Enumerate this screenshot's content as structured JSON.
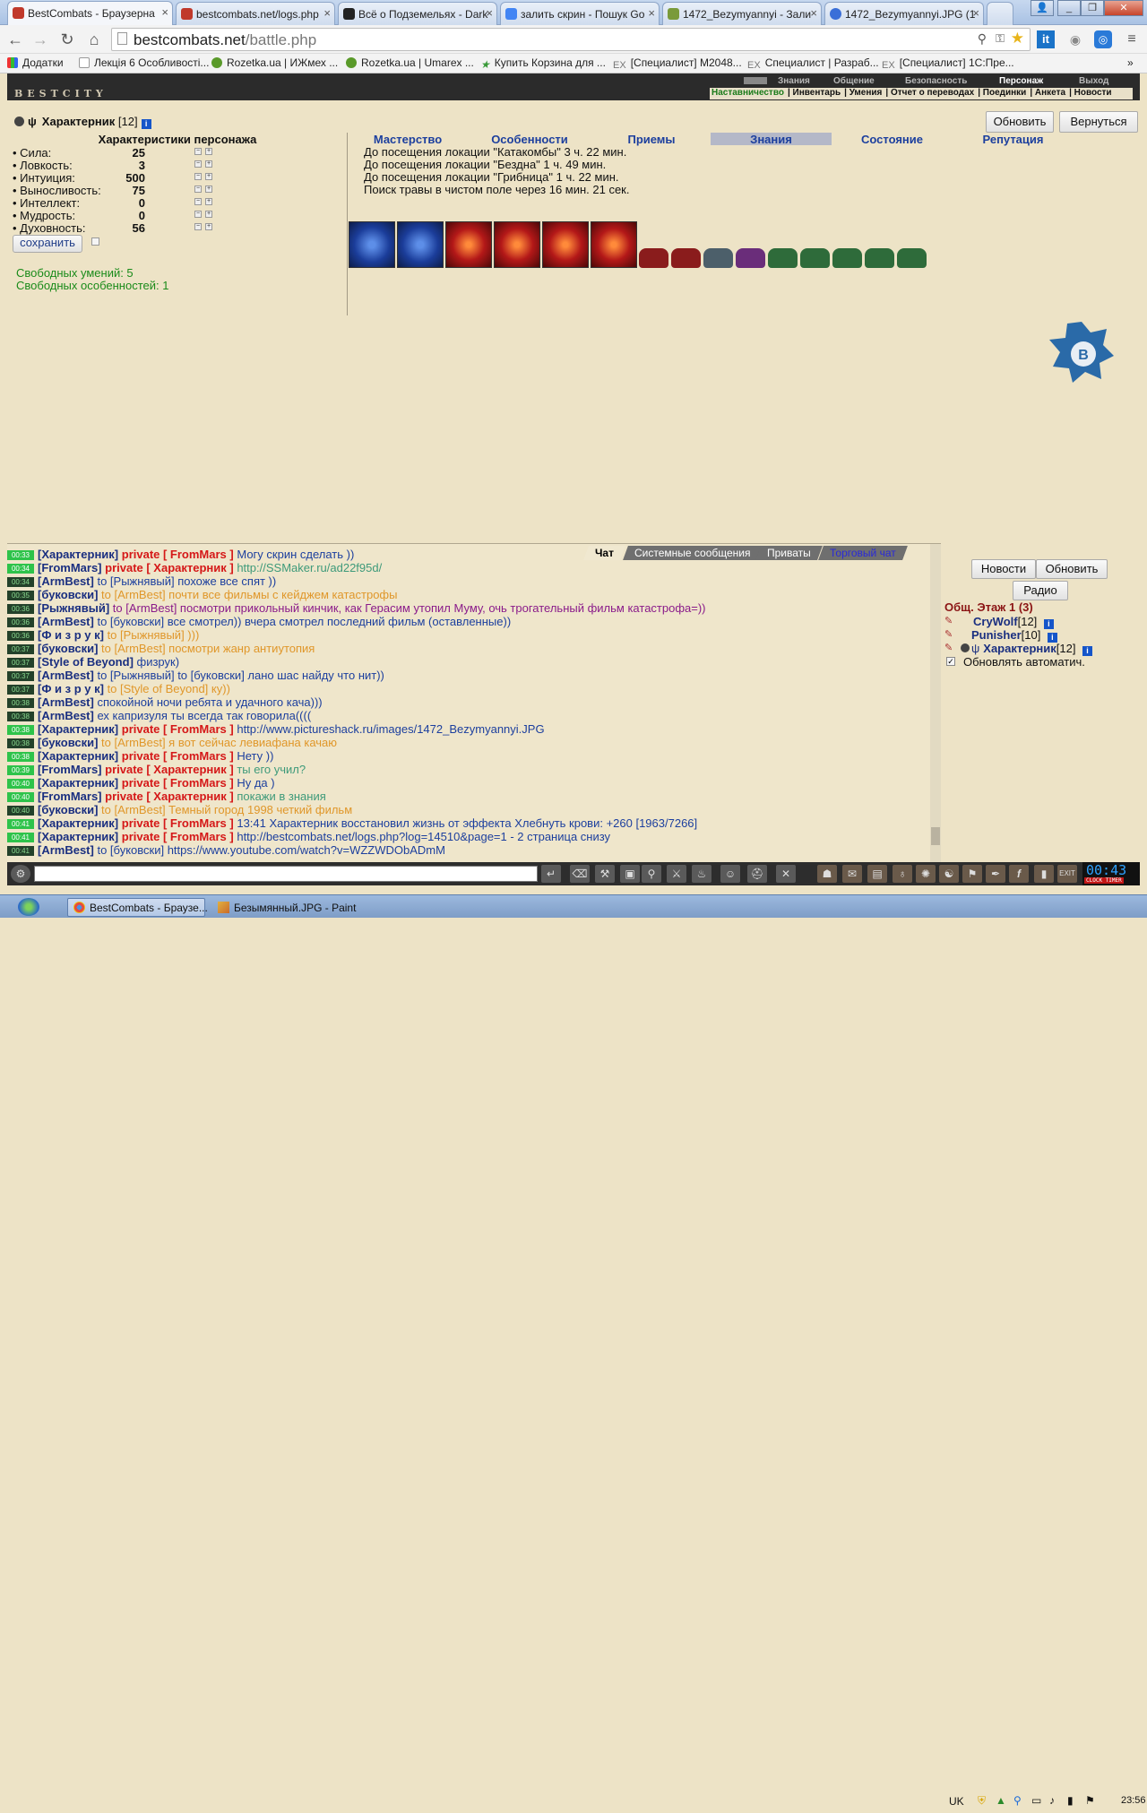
{
  "browser": {
    "tabs": [
      {
        "title": "BestCombats - Браузерна",
        "color": "#c0392b"
      },
      {
        "title": "bestcombats.net/logs.php",
        "color": "#c0392b"
      },
      {
        "title": "Всё о Подземельях - Dark",
        "color": "#222222"
      },
      {
        "title": "залить скрин - Пошук Go",
        "color": "#4285f4"
      },
      {
        "title": "1472_Bezymyannyi - Зали",
        "color": "#7a9a3a"
      },
      {
        "title": "1472_Bezymyannyi.JPG (1",
        "color": "#3a6fd8"
      }
    ],
    "url_host": "bestcombats.net",
    "url_path": "/battle.php",
    "bookmarks": [
      "Додатки",
      "Лекція 6 Особливості...",
      "Rozetka.ua | ИЖмех ...",
      "Rozetka.ua | Umarex ...",
      "Купить Корзина для ...",
      "[Специалист] М2048...",
      "Специалист | Разраб...",
      "[Специалист] 1С:Пре..."
    ]
  },
  "game": {
    "logo": "BESTCITY",
    "top_menu": [
      "Знания",
      "Общение",
      "Безопасность",
      "Персонаж",
      "Выход"
    ],
    "sub_menu": [
      "Наставничество",
      "Инвентарь",
      "Умения",
      "Отчет о переводах",
      "Поединки",
      "Анкета",
      "Новости"
    ],
    "refresh_label": "Обновить",
    "back_label": "Вернуться"
  },
  "character": {
    "name": "Характерник",
    "level": "[12]",
    "stats_title": "Характеристики персонажа",
    "stats": [
      {
        "label": "• Сила:",
        "value": "25"
      },
      {
        "label": "• Ловкость:",
        "value": "3"
      },
      {
        "label": "• Интуиция:",
        "value": "500"
      },
      {
        "label": "• Выносливость:",
        "value": "75"
      },
      {
        "label": "• Интеллект:",
        "value": "0"
      },
      {
        "label": "• Мудрость:",
        "value": "0"
      },
      {
        "label": "• Духовность:",
        "value": "56"
      }
    ],
    "save_label": "сохранить",
    "free_skills": "Свободных умений: 5",
    "free_features": "Свободных особенностей: 1"
  },
  "panel": {
    "tabs": [
      "Мастерство",
      "Особенности",
      "Приемы",
      "Знания",
      "Состояние",
      "Репутация"
    ],
    "active_tab": "Знания",
    "timers": [
      "До посещения локации \"Катакомбы\" 3 ч. 22 мин.",
      "До посещения локации \"Бездна\" 1 ч. 49 мин.",
      "До посещения локации \"Грибница\" 1 ч. 22 мин.",
      "Поиск травы в чистом поле через 16 мин. 21 сек."
    ],
    "books": [
      "blue",
      "blue",
      "red",
      "red",
      "red",
      "red"
    ],
    "armor_colors": [
      "#8a1c1c",
      "#8a1c1c",
      "#9a2222",
      "#4c5f6a",
      "#6a2d7a",
      "#2e6b3a",
      "#2e6b3a",
      "#2e6b3a",
      "#2e6b3a",
      "#2e6b3a"
    ]
  },
  "chat": {
    "tabs": [
      "Чат",
      "Системные сообщения",
      "Приваты",
      "Торговый чат"
    ],
    "lines": [
      {
        "time": "00:33",
        "hl": true,
        "parts": [
          [
            "n",
            "[Характерник] "
          ],
          [
            "pv",
            "private [ FromMars ] "
          ],
          [
            "bl",
            "Могу скрин сделать ))"
          ]
        ]
      },
      {
        "time": "00:34",
        "hl": true,
        "parts": [
          [
            "n",
            "[FromMars] "
          ],
          [
            "pv",
            "private [ Характерник ] "
          ],
          [
            "gr",
            "http://SSMaker.ru/ad22f95d/"
          ]
        ]
      },
      {
        "time": "00:34",
        "hl": false,
        "parts": [
          [
            "n",
            "[ArmBest] "
          ],
          [
            "bl",
            "to [Рыжнявый] похоже все спят ))"
          ]
        ]
      },
      {
        "time": "00:35",
        "hl": false,
        "parts": [
          [
            "n",
            "[буковски] "
          ],
          [
            "or",
            "to [ArmBest] почти все фильмы с кейджем катастрофы"
          ]
        ]
      },
      {
        "time": "00:36",
        "hl": false,
        "parts": [
          [
            "n",
            "[Рыжнявый] "
          ],
          [
            "mr",
            "to [ArmBest] посмотри прикольный кинчик, как Герасим утопил Муму, очь трогательный фильм катастрофа=))"
          ]
        ]
      },
      {
        "time": "00:36",
        "hl": false,
        "parts": [
          [
            "n",
            "[ArmBest] "
          ],
          [
            "bl",
            "to [буковски] все смотрел)) вчера смотрел последний фильм (оставленные))"
          ]
        ]
      },
      {
        "time": "00:36",
        "hl": false,
        "parts": [
          [
            "n",
            "[Ф и з р у к] "
          ],
          [
            "or",
            "to [Рыжнявый] )))"
          ]
        ]
      },
      {
        "time": "00:37",
        "hl": false,
        "parts": [
          [
            "n",
            "[буковски] "
          ],
          [
            "or",
            "to [ArmBest] посмотри жанр антиутопия"
          ]
        ]
      },
      {
        "time": "00:37",
        "hl": false,
        "parts": [
          [
            "n",
            "[Style of Beyond] "
          ],
          [
            "rd",
            "физрук)"
          ]
        ]
      },
      {
        "time": "00:37",
        "hl": false,
        "parts": [
          [
            "n",
            "[ArmBest] "
          ],
          [
            "bl",
            "to [Рыжнявый] to [буковски] лано шас найду что нит))"
          ]
        ]
      },
      {
        "time": "00:37",
        "hl": false,
        "parts": [
          [
            "n",
            "[Ф и з р у к] "
          ],
          [
            "or",
            "to [Style of Beyond] ку))"
          ]
        ]
      },
      {
        "time": "00:38",
        "hl": false,
        "parts": [
          [
            "n",
            "[ArmBest] "
          ],
          [
            "bl",
            "спокойной ночи ребята и удачного кача)))"
          ]
        ]
      },
      {
        "time": "00:38",
        "hl": false,
        "parts": [
          [
            "n",
            "[ArmBest] "
          ],
          [
            "bl",
            "ех капризуля ты всегда так говорила(((("
          ]
        ]
      },
      {
        "time": "00:38",
        "hl": true,
        "parts": [
          [
            "n",
            "[Характерник] "
          ],
          [
            "pv",
            "private [ FromMars ] "
          ],
          [
            "bl",
            "http://www.pictureshack.ru/images/1472_Bezymyannyi.JPG"
          ]
        ]
      },
      {
        "time": "00:38",
        "hl": false,
        "parts": [
          [
            "n",
            "[буковски] "
          ],
          [
            "or",
            "to [ArmBest] я вот сейчас левиафана качаю"
          ]
        ]
      },
      {
        "time": "00:38",
        "hl": true,
        "parts": [
          [
            "n",
            "[Характерник] "
          ],
          [
            "pv",
            "private [ FromMars ] "
          ],
          [
            "bl",
            "Нету ))"
          ]
        ]
      },
      {
        "time": "00:39",
        "hl": true,
        "parts": [
          [
            "n",
            "[FromMars] "
          ],
          [
            "pv",
            "private [ Характерник ] "
          ],
          [
            "gr",
            "ты его учил?"
          ]
        ]
      },
      {
        "time": "00:40",
        "hl": true,
        "parts": [
          [
            "n",
            "[Характерник] "
          ],
          [
            "pv",
            "private [ FromMars ] "
          ],
          [
            "bl",
            "Ну да )"
          ]
        ]
      },
      {
        "time": "00:40",
        "hl": true,
        "parts": [
          [
            "n",
            "[FromMars] "
          ],
          [
            "pv",
            "private [ Характерник ] "
          ],
          [
            "gr",
            "покажи в знания"
          ]
        ]
      },
      {
        "time": "00:40",
        "hl": false,
        "parts": [
          [
            "n",
            "[буковски] "
          ],
          [
            "or",
            "to [ArmBest] Темный город 1998 четкий фильм"
          ]
        ]
      },
      {
        "time": "00:41",
        "hl": true,
        "parts": [
          [
            "n",
            "[Характерник] "
          ],
          [
            "pv",
            "private [ FromMars ] "
          ],
          [
            "bl",
            "13:41 Характерник восстановил жизнь от эффекта Хлебнуть крови: +260 [1963/7266]"
          ]
        ]
      },
      {
        "time": "00:41",
        "hl": true,
        "parts": [
          [
            "n",
            "[Характерник] "
          ],
          [
            "pv",
            "private [ FromMars ] "
          ],
          [
            "bl",
            "http://bestcombats.net/logs.php?log=14510&page=1 - 2 страница снизу"
          ]
        ]
      },
      {
        "time": "00:41",
        "hl": false,
        "parts": [
          [
            "n",
            "[ArmBest] "
          ],
          [
            "bl",
            "to [буковски] https://www.youtube.com/watch?v=WZZWDObADmM"
          ]
        ]
      }
    ]
  },
  "side": {
    "news_label": "Новости",
    "refresh_label": "Обновить",
    "radio_label": "Радио",
    "location": "Общ. Этаж 1 (3)",
    "online": [
      {
        "name": "CryWolf",
        "level": "[12]"
      },
      {
        "name": "Punisher",
        "level": "[10]"
      },
      {
        "name": "Характерник",
        "level": "[12]"
      }
    ],
    "auto_refresh": "Обновлять автоматич."
  },
  "bottom": {
    "clock": "00:43",
    "clock_label": "CLOCK TIMER"
  },
  "taskbar": {
    "tasks": [
      "BestCombats - Браузе...",
      "Безымянный.JPG - Paint"
    ],
    "lang": "UK",
    "time": "23:56"
  }
}
